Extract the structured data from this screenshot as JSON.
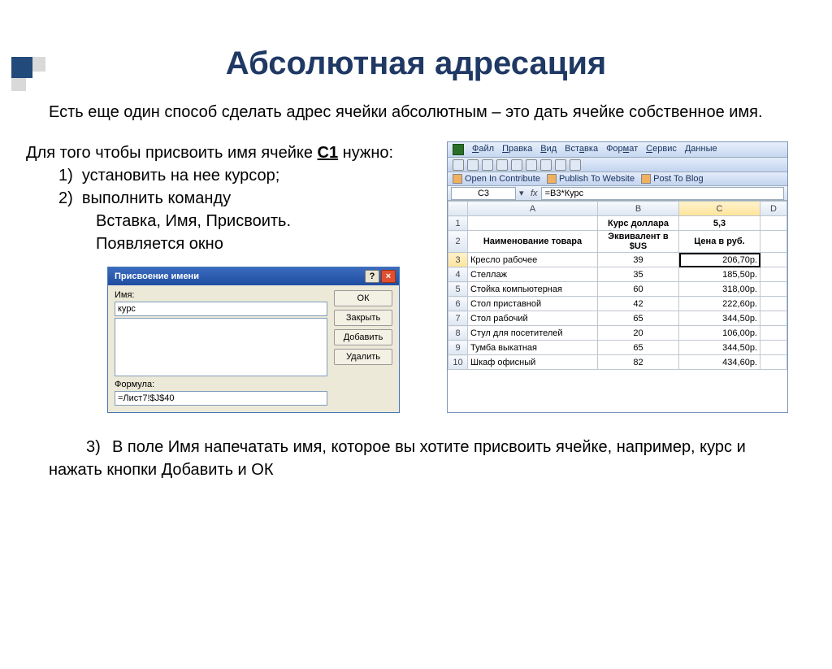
{
  "title": "Абсолютная адресация",
  "intro": "Есть еще один способ сделать адрес ячейки абсолютным – это дать ячейке собственное имя.",
  "instr_lead": "Для того чтобы присвоить имя ячейке ",
  "instr_cell": "С1",
  "instr_tail": " нужно:",
  "steps12": {
    "s1": "установить на нее курсор;",
    "s2a": "выполнить команду",
    "s2b": "Вставка, Имя, Присвоить.",
    "s2c": "Появляется окно"
  },
  "dialog": {
    "title": "Присвоение имени",
    "help": "?",
    "close": "×",
    "label_name": "Имя:",
    "name_value": "курс",
    "label_formula": "Формула:",
    "formula_value": "=Лист7!$J$40",
    "btn_ok": "ОК",
    "btn_close": "Закрыть",
    "btn_add": "Добавить",
    "btn_del": "Удалить"
  },
  "excel": {
    "menu": [
      "Файл",
      "Правка",
      "Вид",
      "Вставка",
      "Формат",
      "Сервис",
      "Данные"
    ],
    "contribute": [
      "Open In Contribute",
      "Publish To Website",
      "Post To Blog"
    ],
    "namebox": "C3",
    "fx": "fx",
    "formula": "=B3*Курс",
    "cols": [
      "A",
      "B",
      "C",
      "D"
    ],
    "row1": {
      "b": "Курс доллара",
      "c": "5,3"
    },
    "row2": {
      "a": "Наименование товара",
      "b": "Эквивалент в $US",
      "c": "Цена в руб."
    },
    "rows": [
      {
        "n": "3",
        "a": "Кресло рабочее",
        "b": "39",
        "c": "206,70р."
      },
      {
        "n": "4",
        "a": "Стеллаж",
        "b": "35",
        "c": "185,50р."
      },
      {
        "n": "5",
        "a": "Стойка компьютерная",
        "b": "60",
        "c": "318,00р."
      },
      {
        "n": "6",
        "a": "Стол приставной",
        "b": "42",
        "c": "222,60р."
      },
      {
        "n": "7",
        "a": "Стол рабочий",
        "b": "65",
        "c": "344,50р."
      },
      {
        "n": "8",
        "a": "Стул для посетителей",
        "b": "20",
        "c": "106,00р."
      },
      {
        "n": "9",
        "a": "Тумба выкатная",
        "b": "65",
        "c": "344,50р."
      },
      {
        "n": "10",
        "a": "Шкаф офисный",
        "b": "82",
        "c": "434,60р."
      }
    ]
  },
  "step3": "В поле Имя напечатать имя, которое вы хотите присвоить ячейке, например, курс и нажать кнопки Добавить и ОК"
}
